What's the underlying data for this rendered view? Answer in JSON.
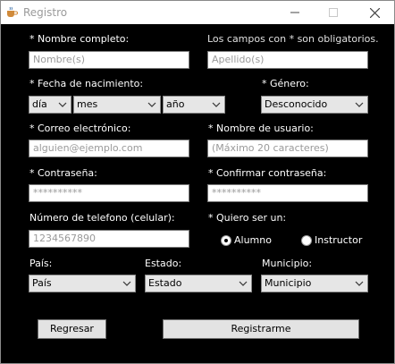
{
  "window": {
    "title": "Registro"
  },
  "form": {
    "nombre_label": "* Nombre completo:",
    "required_note": "Los campos con * son obligatorios.",
    "nombre_placeholder": "Nombre(s)",
    "apellido_placeholder": "Apellido(s)",
    "fecha_label": "* Fecha de nacimiento:",
    "dia_value": "día",
    "mes_value": "mes",
    "anio_value": "año",
    "genero_label": "* Género:",
    "genero_value": "Desconocido",
    "correo_label": "* Correo electrónico:",
    "correo_placeholder": "alguien@ejemplo.com",
    "usuario_label": "* Nombre de usuario:",
    "usuario_placeholder": "(Máximo 20 caracteres)",
    "contrasena_label": "* Contraseña:",
    "contrasena_value": "**********",
    "confirmar_label": "* Confirmar contraseña:",
    "confirmar_value": "**********",
    "telefono_label": "Número de telefono (celular):",
    "telefono_placeholder": "1234567890",
    "rol_label": "* Quiero ser un:",
    "alumno_label": "Alumno",
    "instructor_label": "Instructor",
    "pais_label": "País:",
    "pais_value": "País",
    "estado_label": "Estado:",
    "estado_value": "Estado",
    "municipio_label": "Municipio:",
    "municipio_value": "Municipio",
    "regresar_label": "Regresar",
    "registrarme_label": "Registrarme"
  },
  "selected_role": "Alumno",
  "icons": {
    "app": "java-cup-icon",
    "minimize": "minimize-icon",
    "maximize": "maximize-icon",
    "close": "close-icon",
    "dropdown": "chevron-down-icon"
  },
  "colors": {
    "background": "#000000",
    "label": "#ffffff",
    "placeholder": "#9a9a9a"
  }
}
